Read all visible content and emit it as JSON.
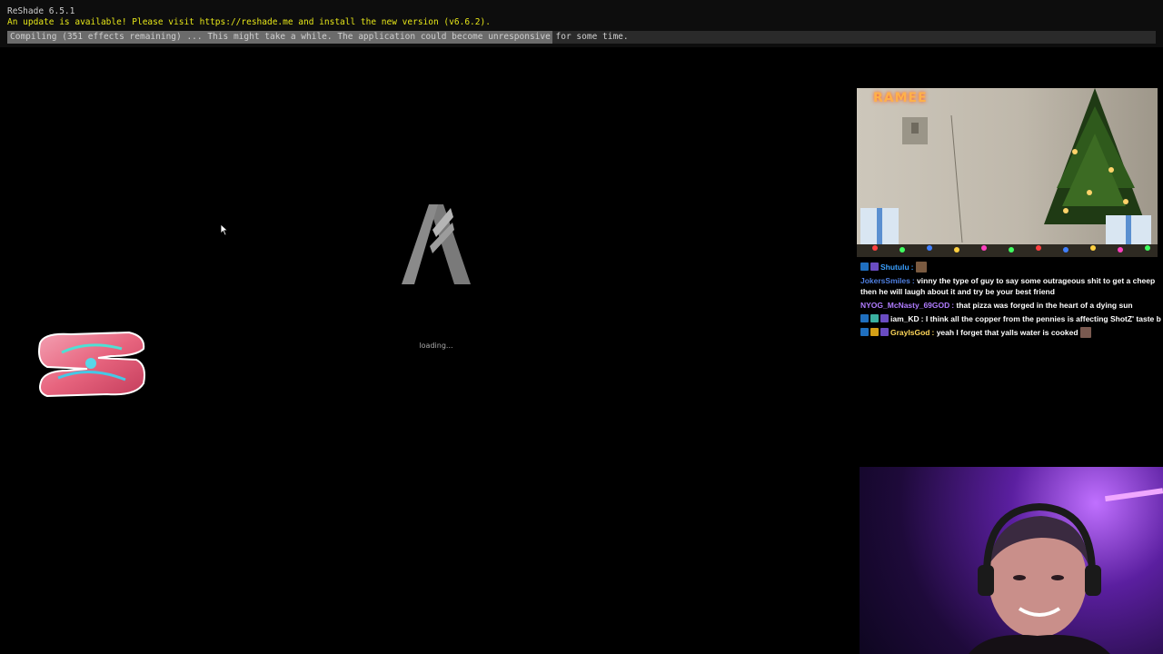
{
  "reshade": {
    "title": "ReShade 6.5.1",
    "update_message": "An update is available! Please visit https://reshade.me and install the new version (v6.6.2).",
    "compile_status": "Compiling (351 effects remaining) ... This might take a while. The application could become unresponsive for some time.",
    "compile_progress_fraction": 0.475
  },
  "game": {
    "loading_text": "loading...",
    "logo_icon": "fivem-logo-icon",
    "badge_icon": "server-badge-icon",
    "cursor_icon": "mouse-cursor-icon"
  },
  "stream_overlay": {
    "webcam_top": {
      "brand": "RAMEE",
      "description_icons": [
        "christmas-tree-icon",
        "gift-box-icon",
        "wall-switch-icon",
        "string-lights-icon"
      ]
    },
    "chat": [
      {
        "user": "Shutulu",
        "user_color": "#3aa0ff",
        "text": "",
        "badges": [
          "#1f6fbf",
          "#6a4cc2"
        ],
        "emote": true
      },
      {
        "user": "JokersSmiles",
        "user_color": "#4f7fe0",
        "text": "vinny the type of guy to say some outrageous shit to get a cheep then he will laugh about it and try be your best friend",
        "badges": [],
        "emote": false
      },
      {
        "user": "NYOG_McNasty_69GOD",
        "user_color": "#b07cff",
        "text": "that pizza was forged in the heart of a dying sun",
        "badges": [],
        "emote": false
      },
      {
        "user": "iam_KD",
        "user_color": "#ffffff",
        "text": "I think all the copper from the pennies is affecting ShotZ' taste b",
        "badges": [
          "#1f6fbf",
          "#3ab0a0",
          "#6a4cc2"
        ],
        "emote": false
      },
      {
        "user": "GrayIsGod",
        "user_color": "#ffd75a",
        "text": "yeah I forget that yalls water is cooked",
        "badges": [
          "#1f6fbf",
          "#d4a017",
          "#6a4cc2"
        ],
        "emote": true
      }
    ],
    "webcam_bottom": {
      "description_icons": [
        "streamer-face-icon",
        "headset-icon",
        "purple-led-light-icon"
      ]
    }
  }
}
